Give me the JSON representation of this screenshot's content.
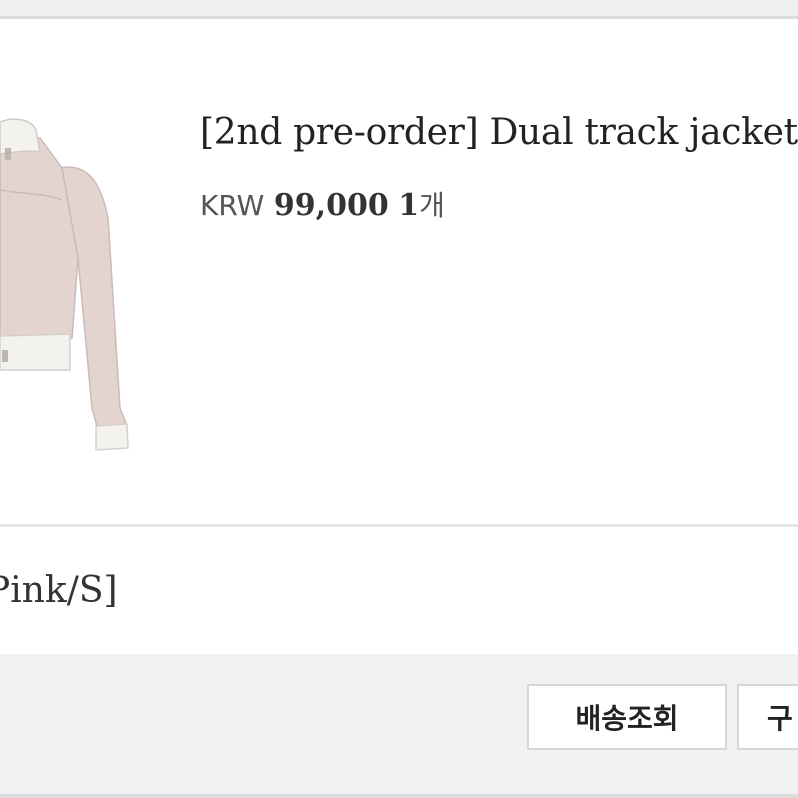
{
  "order_item": {
    "product_name": "[2nd pre-order] Dual track jacket",
    "price": {
      "currency": "KRW",
      "amount": "99,000",
      "quantity": "1",
      "quantity_unit": "개"
    },
    "option": "Pink/S]",
    "image": {
      "subject": "jacket",
      "colors": {
        "body": "#e4d4d0",
        "trim": "#f2f2ee",
        "outline": "#c9b5b1"
      }
    }
  },
  "actions": {
    "track_delivery_label": "배송조회",
    "second_button_label": "구"
  }
}
